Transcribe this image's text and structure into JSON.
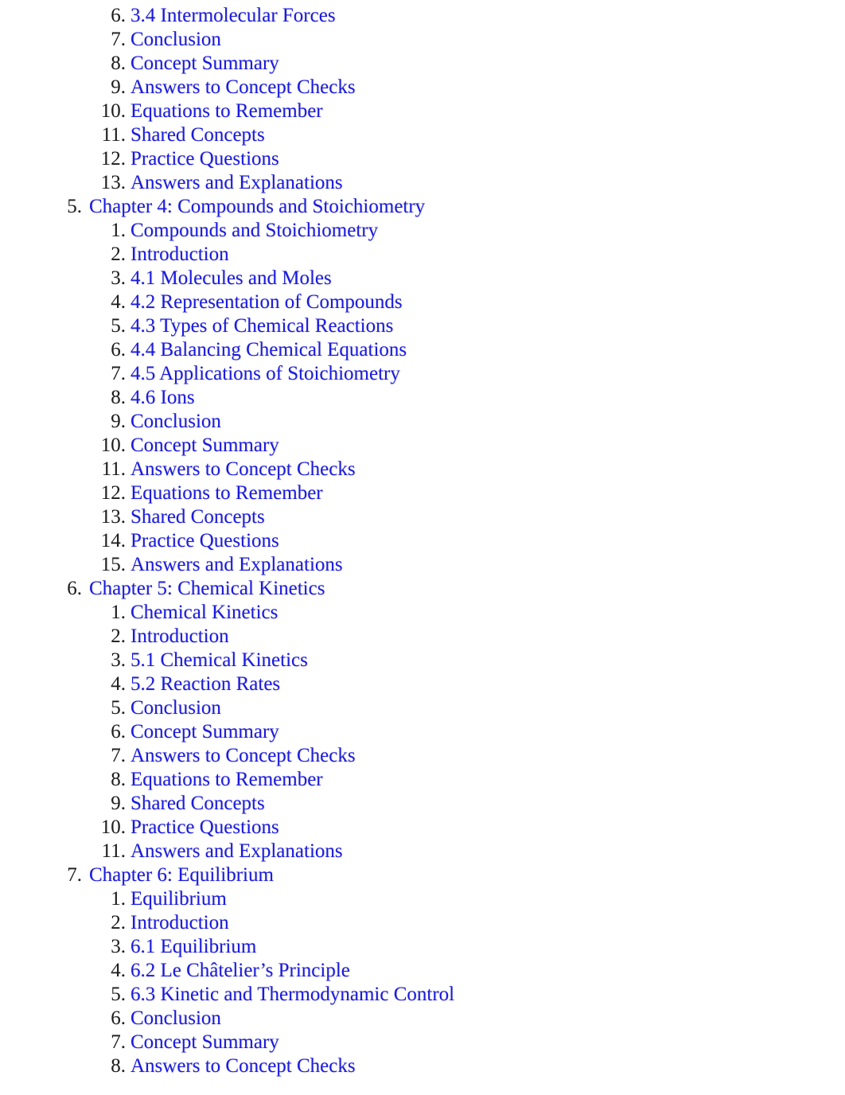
{
  "document": {
    "type": "table-of-contents",
    "background_color": "#ffffff",
    "link_color": "#1a1ae0",
    "marker_color": "#1c1c1c"
  },
  "toc": {
    "top_partial_section": {
      "note": "continuation of Chapter 3 sub-list, page is cropped at top",
      "items": [
        {
          "num": "6.",
          "label": "3.4 Intermolecular Forces"
        },
        {
          "num": "7.",
          "label": "Conclusion"
        },
        {
          "num": "8.",
          "label": "Concept Summary"
        },
        {
          "num": "9.",
          "label": "Answers to Concept Checks"
        },
        {
          "num": "10.",
          "label": "Equations to Remember"
        },
        {
          "num": "11.",
          "label": "Shared Concepts"
        },
        {
          "num": "12.",
          "label": "Practice Questions"
        },
        {
          "num": "13.",
          "label": "Answers and Explanations"
        }
      ]
    },
    "chapters": [
      {
        "num": "5.",
        "label": "Chapter 4: Compounds and Stoichiometry",
        "sections": [
          {
            "num": "1.",
            "label": "Compounds and Stoichiometry"
          },
          {
            "num": "2.",
            "label": "Introduction"
          },
          {
            "num": "3.",
            "label": "4.1 Molecules and Moles"
          },
          {
            "num": "4.",
            "label": "4.2 Representation of Compounds"
          },
          {
            "num": "5.",
            "label": "4.3 Types of Chemical Reactions"
          },
          {
            "num": "6.",
            "label": "4.4 Balancing Chemical Equations"
          },
          {
            "num": "7.",
            "label": "4.5 Applications of Stoichiometry"
          },
          {
            "num": "8.",
            "label": "4.6 Ions"
          },
          {
            "num": "9.",
            "label": "Conclusion"
          },
          {
            "num": "10.",
            "label": "Concept Summary"
          },
          {
            "num": "11.",
            "label": "Answers to Concept Checks"
          },
          {
            "num": "12.",
            "label": "Equations to Remember"
          },
          {
            "num": "13.",
            "label": "Shared Concepts"
          },
          {
            "num": "14.",
            "label": "Practice Questions"
          },
          {
            "num": "15.",
            "label": "Answers and Explanations"
          }
        ]
      },
      {
        "num": "6.",
        "label": "Chapter 5: Chemical Kinetics",
        "sections": [
          {
            "num": "1.",
            "label": "Chemical Kinetics"
          },
          {
            "num": "2.",
            "label": "Introduction"
          },
          {
            "num": "3.",
            "label": "5.1 Chemical Kinetics"
          },
          {
            "num": "4.",
            "label": "5.2 Reaction Rates"
          },
          {
            "num": "5.",
            "label": "Conclusion"
          },
          {
            "num": "6.",
            "label": "Concept Summary"
          },
          {
            "num": "7.",
            "label": "Answers to Concept Checks"
          },
          {
            "num": "8.",
            "label": "Equations to Remember"
          },
          {
            "num": "9.",
            "label": "Shared Concepts"
          },
          {
            "num": "10.",
            "label": "Practice Questions"
          },
          {
            "num": "11.",
            "label": "Answers and Explanations"
          }
        ]
      },
      {
        "num": "7.",
        "label": "Chapter 6: Equilibrium",
        "sections": [
          {
            "num": "1.",
            "label": "Equilibrium"
          },
          {
            "num": "2.",
            "label": "Introduction"
          },
          {
            "num": "3.",
            "label": "6.1 Equilibrium"
          },
          {
            "num": "4.",
            "label": "6.2 Le Châtelier’s Principle"
          },
          {
            "num": "5.",
            "label": "6.3 Kinetic and Thermodynamic Control"
          },
          {
            "num": "6.",
            "label": "Conclusion"
          },
          {
            "num": "7.",
            "label": "Concept Summary"
          },
          {
            "num": "8.",
            "label": "Answers to Concept Checks"
          }
        ]
      }
    ]
  }
}
